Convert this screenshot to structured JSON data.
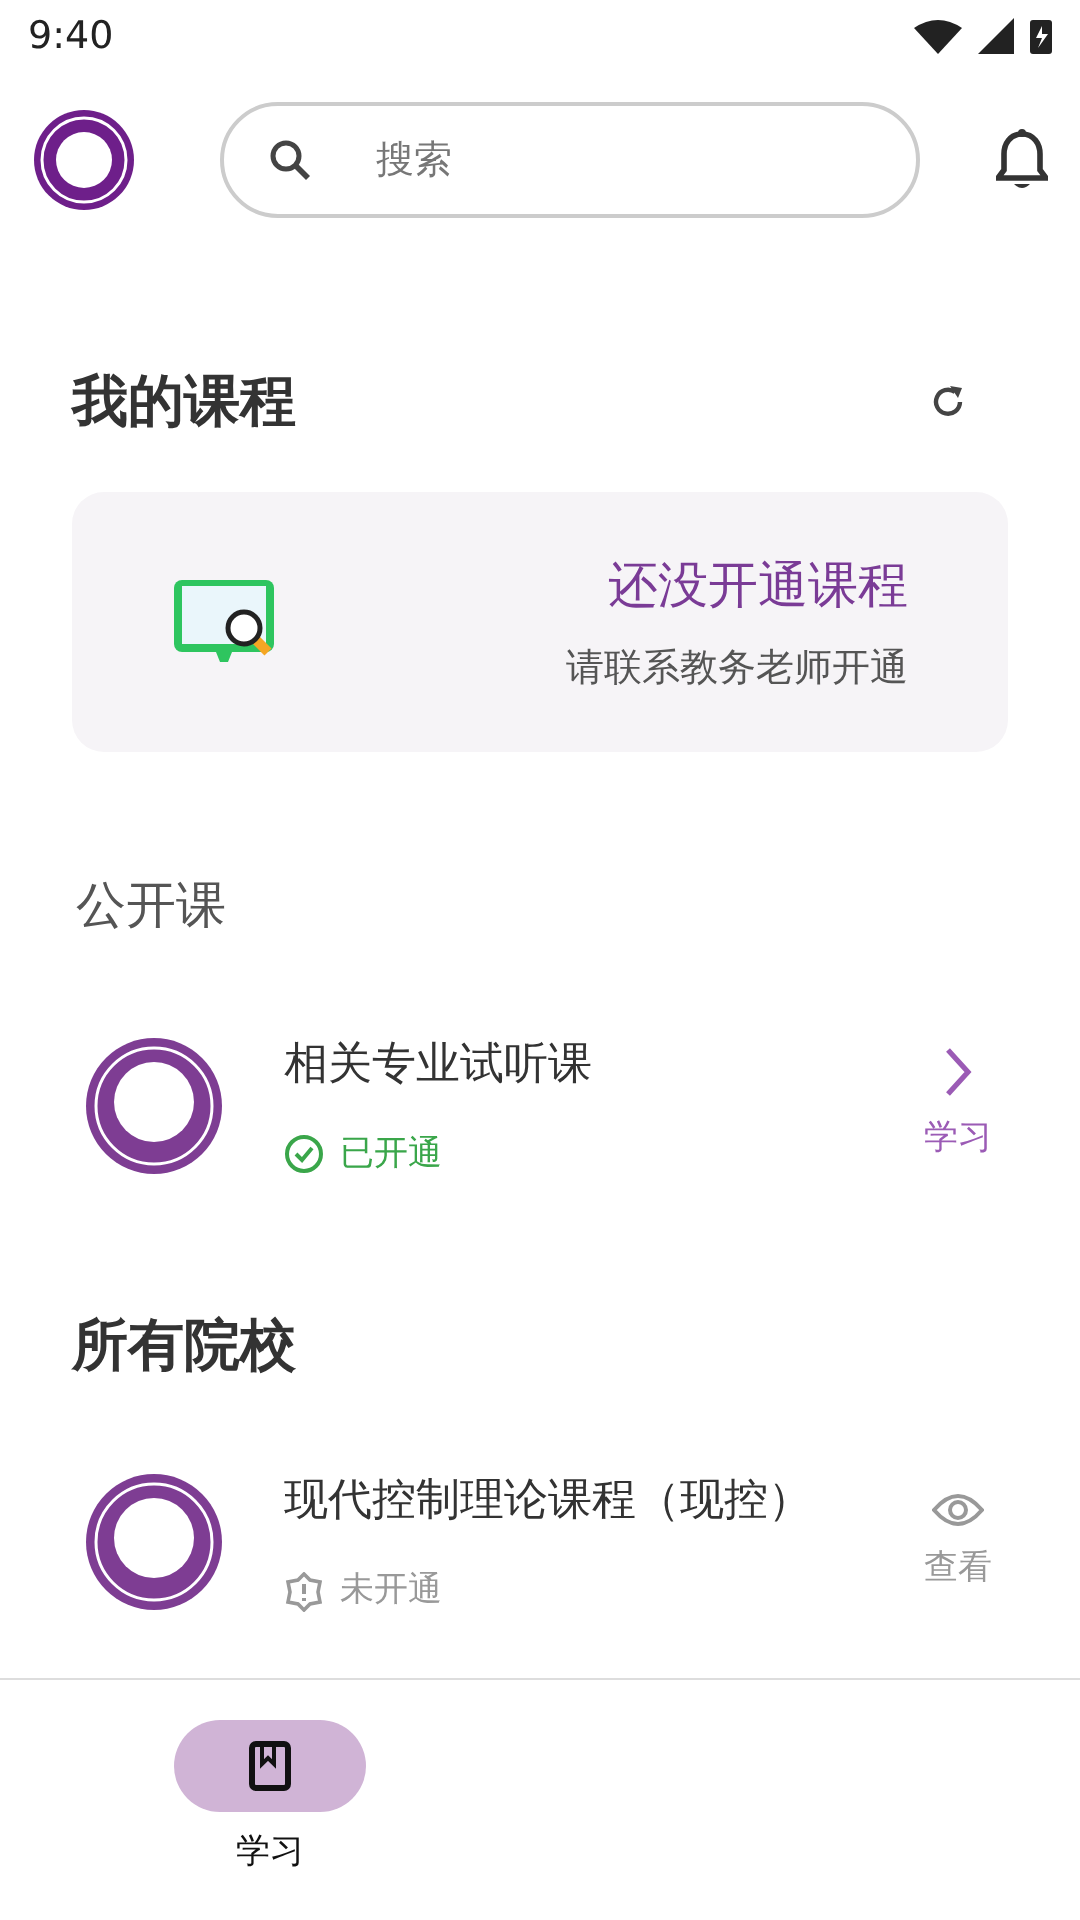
{
  "status_bar": {
    "time": "9:40"
  },
  "header": {
    "search": {
      "placeholder": "搜索"
    }
  },
  "my_courses": {
    "title": "我的课程",
    "empty": {
      "title": "还没开通课程",
      "subtitle": "请联系教务老师开通"
    }
  },
  "open_courses": {
    "title": "公开课",
    "items": [
      {
        "title": "相关专业试听课",
        "status": "已开通",
        "opened": true,
        "action": "学习",
        "kind": "study"
      }
    ]
  },
  "all_schools": {
    "title": "所有院校",
    "items": [
      {
        "title": "现代控制理论课程（现控）",
        "status": "未开通",
        "opened": false,
        "action": "查看",
        "kind": "view"
      }
    ]
  },
  "bottom_nav": [
    {
      "label": "学习",
      "selected": true
    }
  ]
}
